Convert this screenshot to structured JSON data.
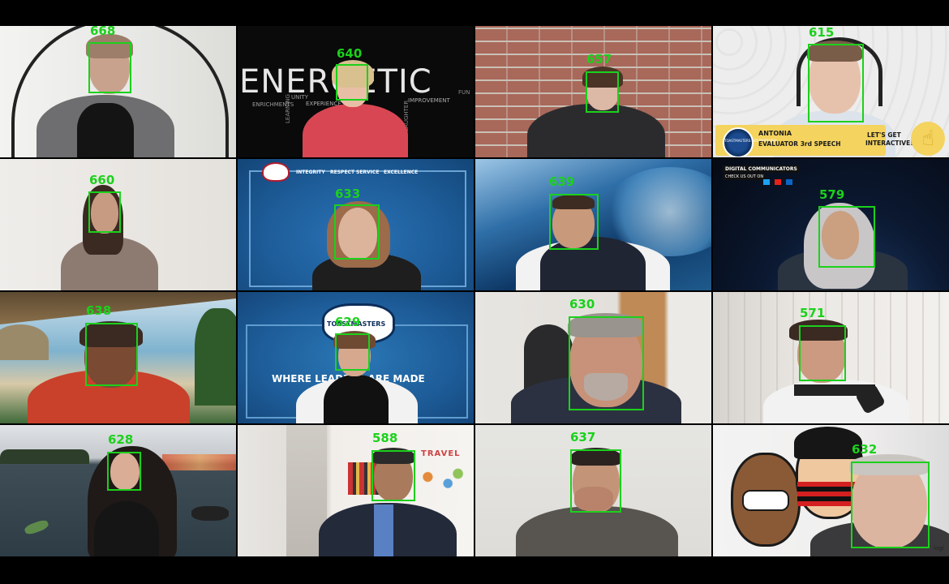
{
  "tiles": [
    {
      "face_id": "668"
    },
    {
      "face_id": "640",
      "background_word": "ENERGETIC",
      "small_words": [
        "ENRICHMENTS",
        "UNITY",
        "EXPERIENCE",
        "LEARNING",
        "LAUGHTER",
        "IMPROVEMENT",
        "FUN"
      ]
    },
    {
      "face_id": "657"
    },
    {
      "face_id": "615",
      "name_tag": "ANTONIA",
      "role_tag": "EVALUATOR 3rd SPEECH",
      "banner_brand": "TOASTMASTERS INTERNATIONAL",
      "cta_line1": "LET'S GET",
      "cta_line2": "INTERACTIVE!"
    },
    {
      "face_id": "660"
    },
    {
      "face_id": "633",
      "values": [
        "INTEGRITY",
        "RESPECT",
        "SERVICE",
        "EXCELLENCE"
      ]
    },
    {
      "face_id": "639"
    },
    {
      "face_id": "579",
      "club_line1": "DIGITAL COMMUNICATORS",
      "club_line2": "CHECK US OUT ON"
    },
    {
      "face_id": "638"
    },
    {
      "face_id": "629",
      "sign_brand": "TOASTMASTERS",
      "slogan": "WHERE LEADERS ARE MADE"
    },
    {
      "face_id": "630"
    },
    {
      "face_id": "571"
    },
    {
      "face_id": "628"
    },
    {
      "face_id": "588",
      "wall_text": "TRAVEL"
    },
    {
      "face_id": "637"
    },
    {
      "face_id": "632",
      "watermark": "logi"
    }
  ],
  "colors": {
    "detection_box": "#1bd11b",
    "background": "#000000"
  }
}
